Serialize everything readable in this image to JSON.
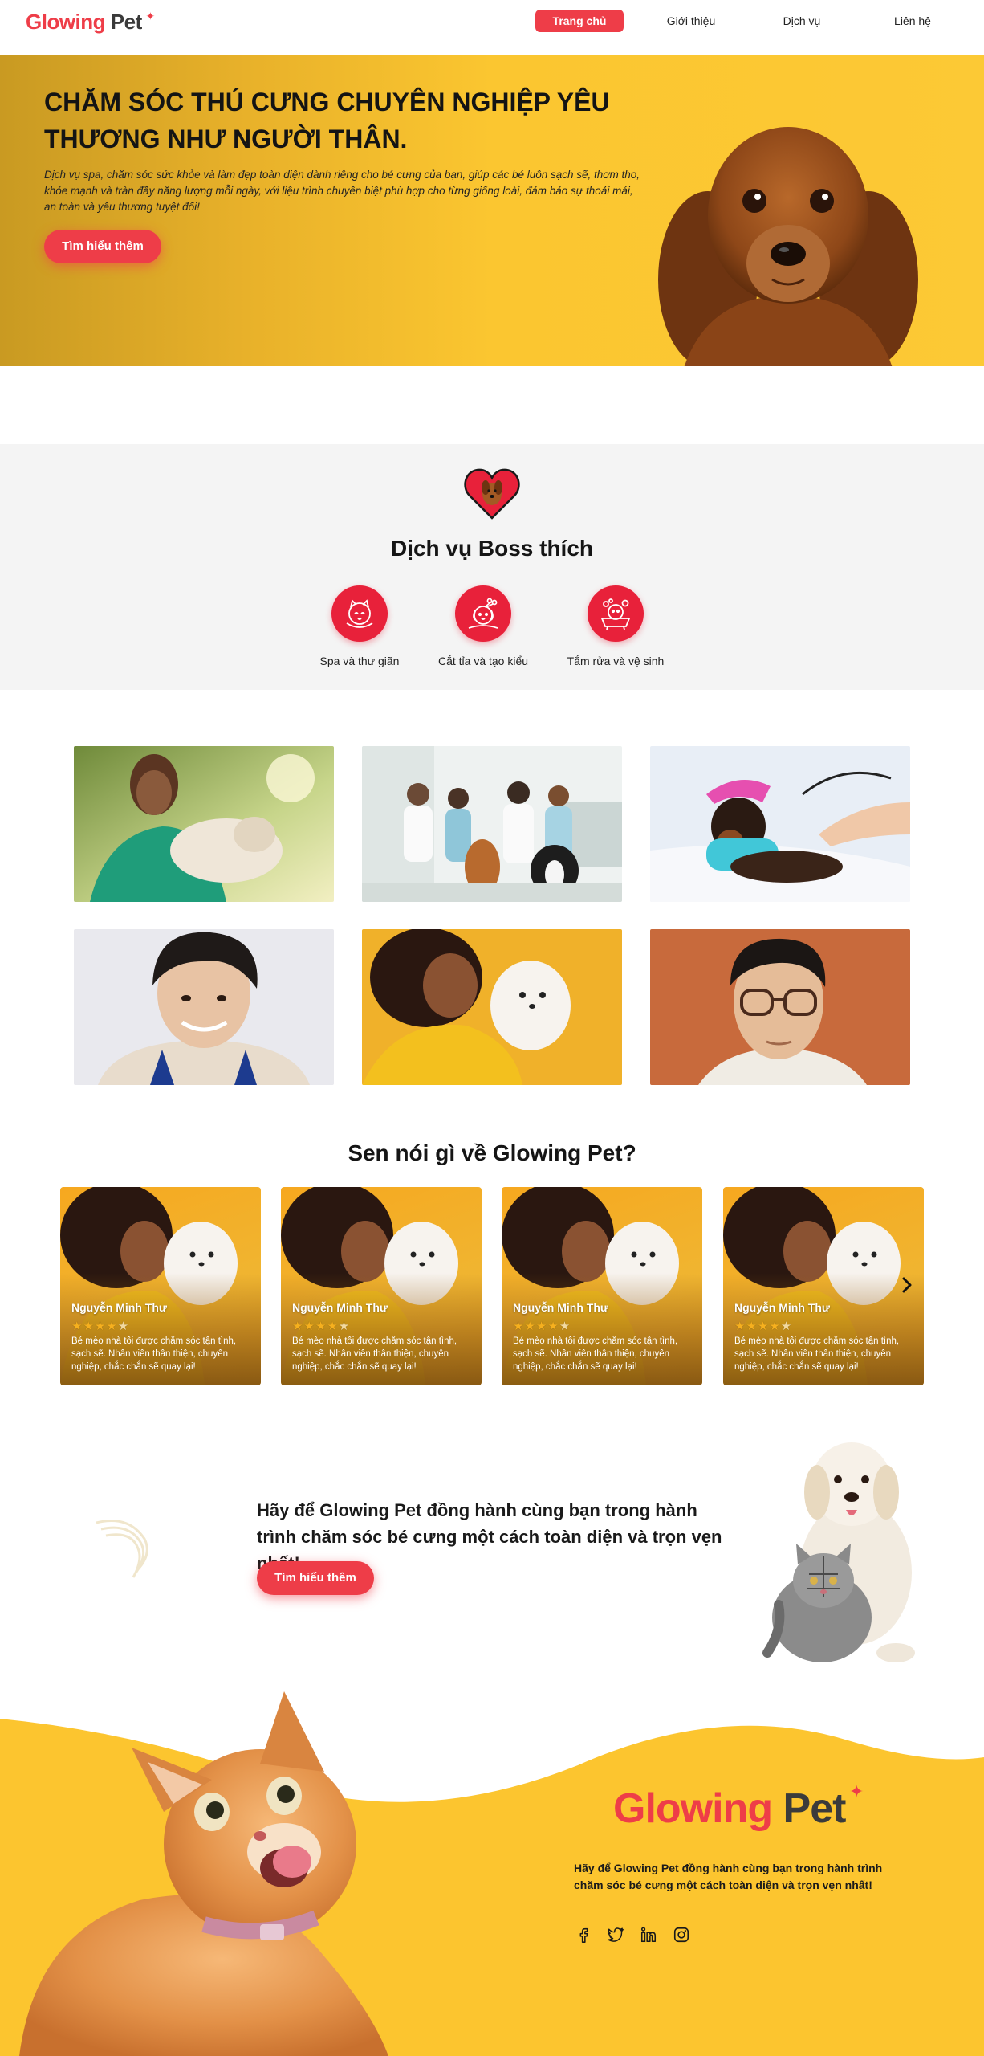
{
  "brand": {
    "logo_part1": "Glowing",
    "logo_part2": "Pet",
    "spark": "✦",
    "primary_color": "#ee3d48",
    "accent_yellow": "#fcc935"
  },
  "nav": {
    "items": [
      {
        "label": "Trang chủ",
        "active": true
      },
      {
        "label": "Giới thiệu",
        "active": false
      },
      {
        "label": "Dịch vụ",
        "active": false
      },
      {
        "label": "Liên hệ",
        "active": false
      }
    ]
  },
  "hero": {
    "title": "CHĂM SÓC THÚ CƯNG CHUYÊN NGHIỆP YÊU THƯƠNG NHƯ NGƯỜI THÂN.",
    "description": "Dịch vụ spa, chăm sóc sức khỏe và làm đẹp toàn diện dành riêng cho bé cưng của bạn, giúp các bé luôn sạch sẽ, thơm tho, khỏe mạnh và tràn đầy năng lượng mỗi ngày, với liệu trình chuyên biệt phù hợp cho từng giống loài, đảm bảo sự thoải mái, an toàn và yêu thương tuyệt đối!",
    "button": "Tìm hiểu thêm",
    "image_icon": "dachshund-dog-photo"
  },
  "services": {
    "title": "Dịch vụ Boss thích",
    "header_icon": "heart-dog-icon",
    "items": [
      {
        "label": "Spa và thư giãn",
        "icon": "spa-cat-icon"
      },
      {
        "label": "Cắt tỉa và tạo kiểu",
        "icon": "grooming-scissors-icon"
      },
      {
        "label": "Tắm rửa và vệ sinh",
        "icon": "bath-bubbles-icon"
      }
    ]
  },
  "gallery": {
    "photos": [
      "vet-with-dog-photo",
      "vet-team-with-dogs-photo",
      "dachshund-checkup-photo",
      "smiling-young-man-photo",
      "woman-with-pomeranian-photo",
      "man-with-glasses-photo"
    ]
  },
  "testimonials": {
    "title": "Sen nói gì về Glowing Pet?",
    "next_icon": "chevron-right-icon",
    "items": [
      {
        "name": "Nguyễn Minh Thư",
        "rating": 4,
        "text": "Bé mèo nhà tôi được chăm sóc tận tình, sạch sẽ. Nhân viên thân thiện, chuyên nghiệp, chắc chắn sẽ quay lại!"
      },
      {
        "name": "Nguyễn Minh Thư",
        "rating": 4,
        "text": "Bé mèo nhà tôi được chăm sóc tận tình, sạch sẽ. Nhân viên thân thiện, chuyên nghiệp, chắc chắn sẽ quay lại!"
      },
      {
        "name": "Nguyễn Minh Thư",
        "rating": 4,
        "text": "Bé mèo nhà tôi được chăm sóc tận tình, sạch sẽ. Nhân viên thân thiện, chuyên nghiệp, chắc chắn sẽ quay lại!"
      },
      {
        "name": "Nguyễn Minh Thư",
        "rating": 4,
        "text": "Bé mèo nhà tôi được chăm sóc tận tình, sạch sẽ. Nhân viên thân thiện, chuyên nghiệp, chắc chắn sẽ quay lại!"
      }
    ]
  },
  "cta": {
    "text": "Hãy để Glowing Pet đồng hành cùng bạn trong hành trình chăm sóc bé cưng một cách toàn diện và trọn vẹn nhất!",
    "button": "Tìm hiểu thêm",
    "image_icon": "puppy-and-cat-photo"
  },
  "footer": {
    "logo_part1": "Glowing",
    "logo_part2": "Pet",
    "text": "Hãy để Glowing Pet đồng hành cùng bạn trong hành trình chăm sóc bé cưng một cách toàn diện và trọn vẹn nhất!",
    "social": [
      "facebook-icon",
      "twitter-icon",
      "linkedin-icon",
      "instagram-icon"
    ],
    "image_icon": "orange-cat-photo"
  }
}
